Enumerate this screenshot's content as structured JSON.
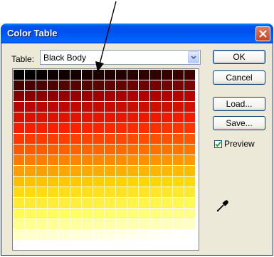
{
  "window": {
    "title": "Color Table"
  },
  "table_selector": {
    "label": "Table:",
    "selected": "Black Body"
  },
  "buttons": {
    "ok": "OK",
    "cancel": "Cancel",
    "load": "Load...",
    "save": "Save..."
  },
  "preview": {
    "label": "Preview",
    "checked": true
  },
  "palette": {
    "name": "Black Body",
    "columns": 16,
    "rows": 16,
    "cell_count": 256,
    "color_stops": [
      "#000000",
      "#b00000",
      "#ff2000",
      "#ff7800",
      "#ffd400",
      "#ffff60",
      "#ffffff"
    ]
  },
  "icons": {
    "close": "close-icon",
    "dropdown": "chevron-down-icon",
    "eyedropper": "eyedropper-icon",
    "annotation": "arrow-annotation"
  }
}
